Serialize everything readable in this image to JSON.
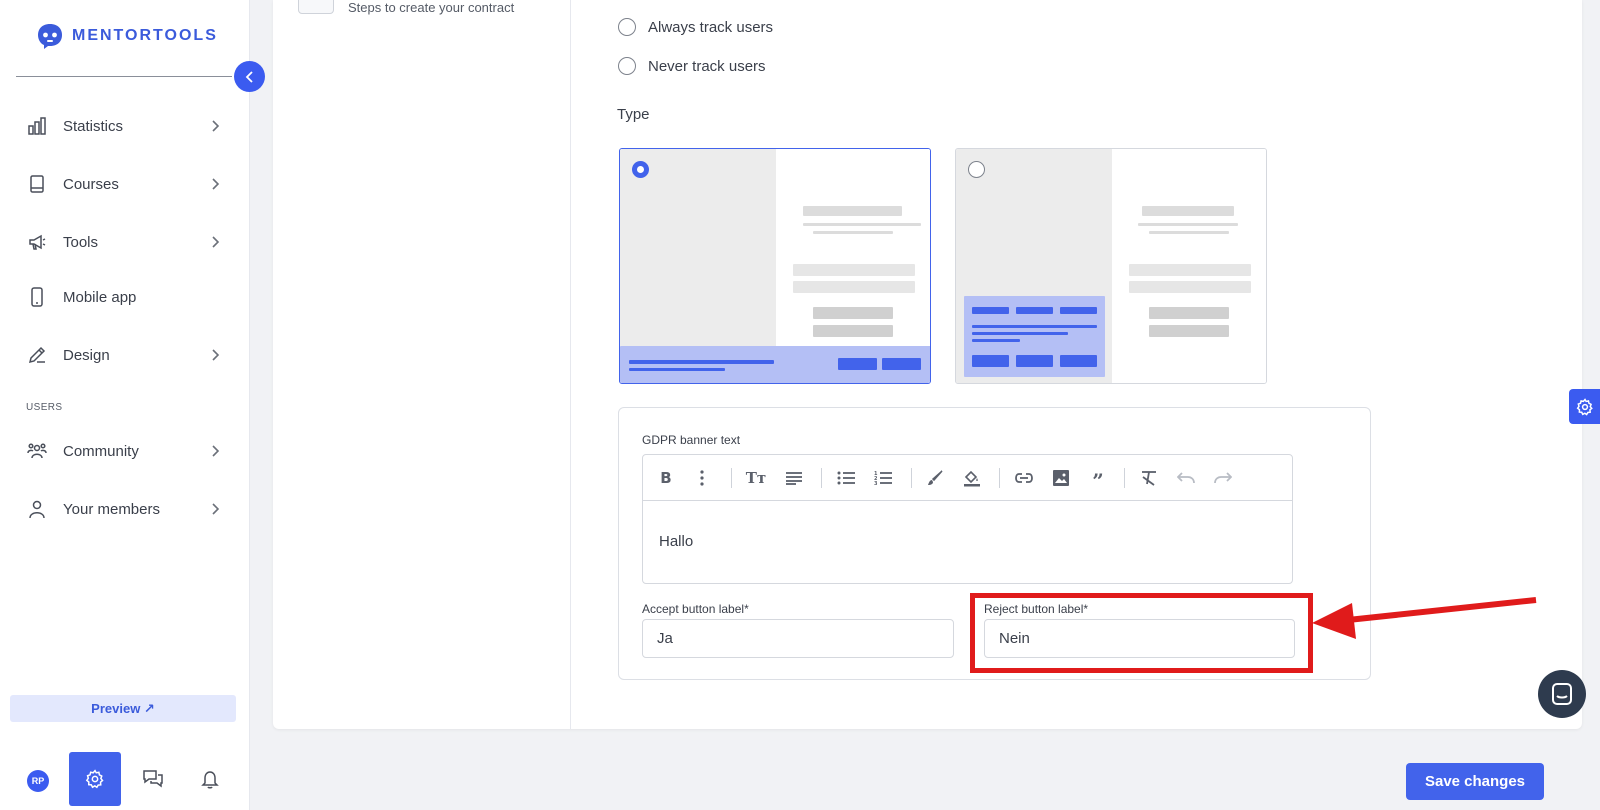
{
  "app": {
    "logo_text": "MENTORTOOLS"
  },
  "sidebar": {
    "items": [
      {
        "label": "Statistics",
        "icon": "bar-chart-icon"
      },
      {
        "label": "Courses",
        "icon": "book-icon"
      },
      {
        "label": "Tools",
        "icon": "megaphone-icon"
      },
      {
        "label": "Mobile app",
        "icon": "mobile-icon"
      },
      {
        "label": "Design",
        "icon": "pencil-icon"
      },
      {
        "label": "Community",
        "icon": "community-icon"
      },
      {
        "label": "Your members",
        "icon": "user-icon"
      }
    ],
    "section_users": "USERS",
    "preview_label": "Preview ↗",
    "avatar_initials": "RP"
  },
  "steps": {
    "subtitle": "Steps to create your contract"
  },
  "tracking": {
    "options": [
      "Always track users",
      "Never track users"
    ]
  },
  "type_section": {
    "label": "Type",
    "selected_index": 0
  },
  "gdpr": {
    "banner_text_label": "GDPR banner text",
    "banner_text_value": "Hallo",
    "accept_label": "Accept button label*",
    "accept_value": "Ja",
    "reject_label": "Reject button label*",
    "reject_value": "Nein"
  },
  "footer": {
    "save_label": "Save changes"
  },
  "colors": {
    "accent": "#4263eb",
    "highlight": "#e01b1b",
    "preview_fill": "#b4bff5"
  }
}
